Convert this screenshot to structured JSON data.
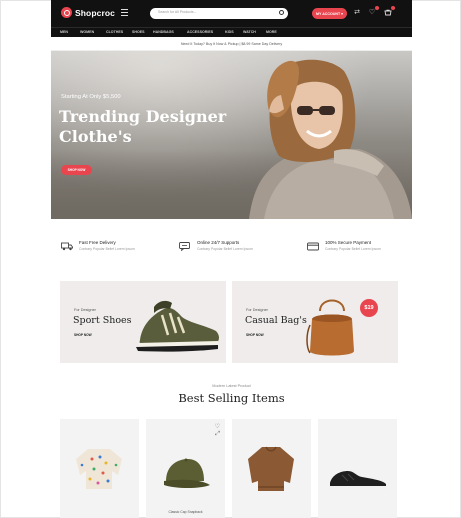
{
  "brand": {
    "name": "Shopcroc",
    "accent": "#e9454f",
    "dark": "#111111"
  },
  "header": {
    "search_placeholder": "Search for All Products...",
    "account_label": "MY ACCOUNT",
    "icons": [
      "menu-icon",
      "search-icon",
      "compare-icon",
      "wishlist-icon",
      "cart-icon"
    ]
  },
  "nav": {
    "items": [
      "Men",
      "Women",
      "Clothes",
      "Shoes",
      "Handbags",
      "Accessories",
      "Kids",
      "Watch",
      "More"
    ]
  },
  "announcement": "Need It Today? Buy It Now & Pickup | $8.99 Same Day Delivery",
  "hero": {
    "subtitle": "Starting At Only $5,500",
    "title_line1": "Trending Designer",
    "title_line2": "Clothe's",
    "button": "SHOP NOW"
  },
  "features": [
    {
      "title": "Fast Free Delivery",
      "desc": "Contrary Popular Belief Lorem Ipsum",
      "icon": "truck-icon"
    },
    {
      "title": "Online 24/7 Supports",
      "desc": "Contrary Popular Belief Lorem Ipsum",
      "icon": "chat-icon"
    },
    {
      "title": "100% Secure Payment",
      "desc": "Contrary Popular Belief Lorem Ipsum",
      "icon": "credit-card-icon"
    }
  ],
  "promos": [
    {
      "eyebrow": "For Designer",
      "title": "Sport Shoes",
      "link": "SHOP NOW"
    },
    {
      "eyebrow": "For Designer",
      "title": "Casual Bag's",
      "link": "SHOP NOW",
      "price": "$19"
    }
  ],
  "best_selling": {
    "eyebrow": "Modern Latest Product",
    "title": "Best Selling Items",
    "products": [
      {
        "image": "sweater-image"
      },
      {
        "image": "cap-image",
        "name": "Classic Cap Snapback"
      },
      {
        "image": "brown-sweater-image"
      },
      {
        "image": "sneaker-image"
      }
    ]
  }
}
